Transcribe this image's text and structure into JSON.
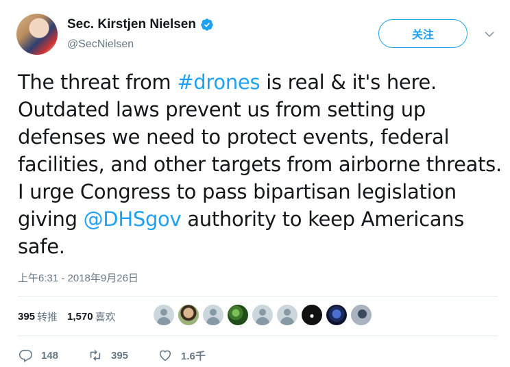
{
  "user": {
    "name": "Sec. Kirstjen Nielsen",
    "handle": "@SecNielsen"
  },
  "follow_label": "关注",
  "tweet": {
    "seg1": "The threat from ",
    "hashtag": "#drones",
    "seg2": " is real & it's here. Outdated laws prevent us from setting up defenses we need to protect events, federal facilities, and other targets from airborne threats. I urge Congress to pass bipartisan legislation giving ",
    "mention": "@DHSgov",
    "seg3": " authority to keep Americans safe."
  },
  "timestamp": "上午6:31 - 2018年9月26日",
  "stats": {
    "retweets_count": "395",
    "retweets_label": "转推",
    "likes_count": "1,570",
    "likes_label": "喜欢"
  },
  "actions": {
    "replies": "148",
    "retweets": "395",
    "likes": "1.6千"
  },
  "colors": {
    "accent": "#1da1f2",
    "text": "#14171a",
    "muted": "#657786",
    "divider": "#e6ecf0"
  },
  "icons": {
    "verified": "verified-badge-icon",
    "caret": "chevron-down-icon",
    "reply": "reply-icon",
    "retweet": "retweet-icon",
    "like": "heart-icon"
  }
}
